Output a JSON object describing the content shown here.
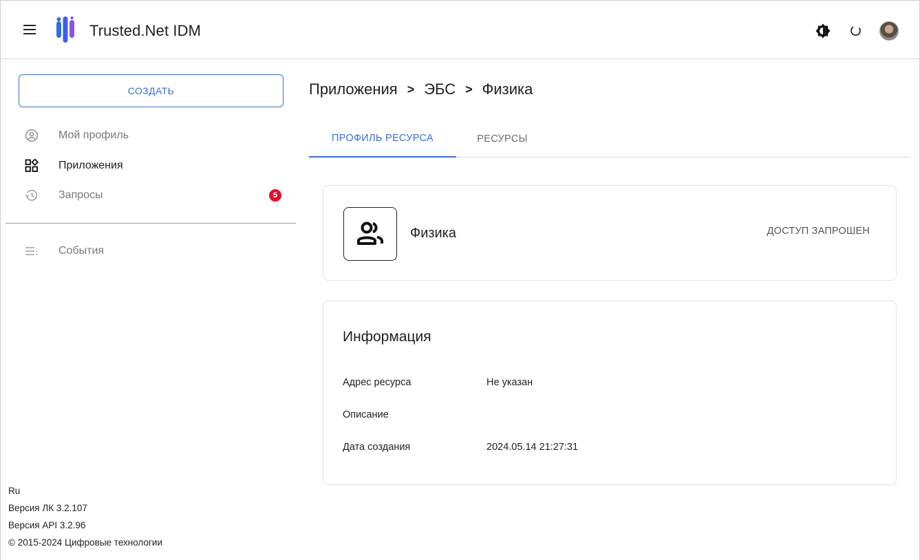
{
  "app": {
    "title": "Trusted.Net IDM"
  },
  "topbar": {
    "menu_icon": "hamburger-icon",
    "theme_icon": "brightness-icon",
    "refresh_icon": "refresh-icon",
    "avatar_icon": "user-avatar"
  },
  "sidebar": {
    "create_label": "СОЗДАТЬ",
    "items": [
      {
        "label": "Мой профиль",
        "icon": "account-circle-icon"
      },
      {
        "label": "Приложения",
        "icon": "apps-icon"
      },
      {
        "label": "Запросы",
        "icon": "history-icon",
        "badge": "5"
      },
      {
        "label": "События",
        "icon": "list-icon"
      }
    ],
    "footer": {
      "lang": "Ru",
      "version_lk": "Версия ЛК 3.2.107",
      "version_api": "Версия API 3.2.96",
      "copyright": "© 2015-2024 Цифровые технологии"
    }
  },
  "breadcrumb": {
    "items": [
      "Приложения",
      "ЭБС",
      "Физика"
    ],
    "separator": ">"
  },
  "tabs": [
    {
      "label": "ПРОФИЛЬ РЕСУРСА"
    },
    {
      "label": "РЕСУРСЫ"
    }
  ],
  "resource": {
    "icon": "group-icon",
    "name": "Физика",
    "status": "ДОСТУП ЗАПРОШЕН"
  },
  "info": {
    "title": "Информация",
    "rows": [
      {
        "key": "Адрес ресурса",
        "value": "Не указан"
      },
      {
        "key": "Описание",
        "value": ""
      },
      {
        "key": "Дата создания",
        "value": "2024.05.14 21:27:31"
      }
    ]
  },
  "colors": {
    "accent": "#3a6fd8",
    "badge": "#e0102d",
    "logo_blue": "#2f6fe0",
    "logo_purple": "#8a52e8"
  }
}
